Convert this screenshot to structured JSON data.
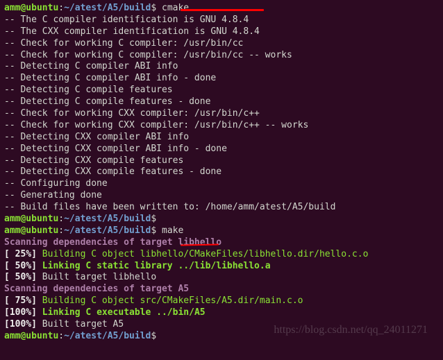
{
  "prompt": {
    "userhost": "amm@ubuntu",
    "path": "~/atest/A5/build",
    "sep1": ":",
    "sep2": "$"
  },
  "cmd1": "cmake ..",
  "cmd2": "make",
  "cmake_lines": [
    "-- The C compiler identification is GNU 4.8.4",
    "-- The CXX compiler identification is GNU 4.8.4",
    "-- Check for working C compiler: /usr/bin/cc",
    "-- Check for working C compiler: /usr/bin/cc -- works",
    "-- Detecting C compiler ABI info",
    "-- Detecting C compiler ABI info - done",
    "-- Detecting C compile features",
    "-- Detecting C compile features - done",
    "-- Check for working CXX compiler: /usr/bin/c++",
    "-- Check for working CXX compiler: /usr/bin/c++ -- works",
    "-- Detecting CXX compiler ABI info",
    "-- Detecting CXX compiler ABI info - done",
    "-- Detecting CXX compile features",
    "-- Detecting CXX compile features - done",
    "-- Configuring done",
    "-- Generating done",
    "-- Build files have been written to: /home/amm/atest/A5/build"
  ],
  "make": {
    "scan1": "Scanning dependencies of target libhello",
    "p25": "[ 25%] ",
    "p50": "[ 50%] ",
    "p75": "[ 75%] ",
    "p100": "[100%] ",
    "buildc1": "Building C object libhello/CMakeFiles/libhello.dir/hello.c.o",
    "link1": "Linking C static library ../lib/libhello.a",
    "built1": "Built target libhello",
    "scan2": "Scanning dependencies of target A5",
    "buildc2": "Building C object src/CMakeFiles/A5.dir/main.c.o",
    "link2": "Linking C executable ../bin/A5",
    "built2": "Built target A5"
  },
  "watermark": "https://blog.csdn.net/qq_24011271"
}
